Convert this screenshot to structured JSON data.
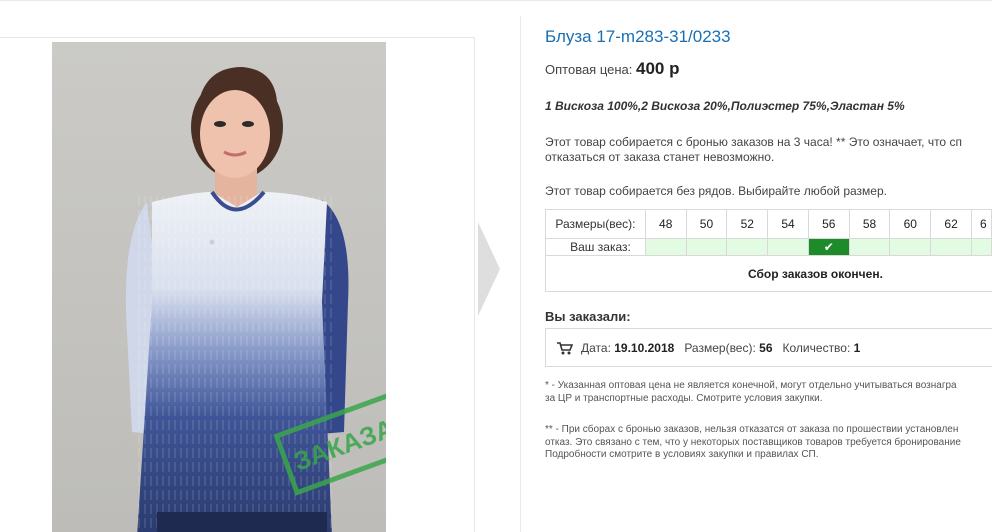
{
  "product": {
    "title": "Блуза 17-m283-31/0233",
    "price_label": "Оптовая цена:",
    "price_value": "400 р",
    "composition": "1 Вискоза 100%,2 Вискоза 20%,Полиэстер 75%,Эластан 5%",
    "notice_line1": "Этот товар собирается с бронью заказов на 3 часа! ** Это означает, что сп",
    "notice_line2": "отказаться от заказа станет невозможно.",
    "no_rows": "Этот товар собирается без рядов. Выбирайте любой размер."
  },
  "stamp": {
    "text": "ЗАКАЗАНО",
    "color": "#3aa64a"
  },
  "sizes": {
    "header_label": "Размеры(вес):",
    "order_label": "Ваш заказ:",
    "values": [
      "48",
      "50",
      "52",
      "54",
      "56",
      "58",
      "60",
      "62",
      "6"
    ],
    "selected": "56",
    "closed_text": "Сбор заказов окончен."
  },
  "ordered": {
    "title": "Вы заказали:",
    "date_label": "Дата:",
    "date_value": "19.10.2018",
    "size_label": "Размер(вес):",
    "size_value": "56",
    "qty_label": "Количество:",
    "qty_value": "1"
  },
  "footnotes": {
    "f1_line1": "* - Указанная оптовая цена не является конечной, могут отдельно учитываться вознагра",
    "f1_line2": "за ЦР и транспортные расходы. Смотрите условия закупки.",
    "f2_line1": "** - При сборах с бронью заказов, нельзя отказатся от заказа по прошествии установлен",
    "f2_line2": "отказ. Это связано с тем, что у некоторых поставщиков товаров требуется бронирование",
    "f2_line3": "Подробности смотрите в условиях закупки и правилах СП."
  },
  "colors": {
    "link": "#1a6fb4",
    "selected_cell": "#1e8b2a",
    "available_cell": "#e3fbe3"
  }
}
